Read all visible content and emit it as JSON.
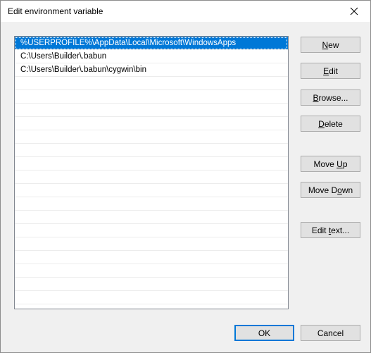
{
  "window": {
    "title": "Edit environment variable",
    "close_icon": "close-icon"
  },
  "paths": {
    "items": [
      {
        "value": "%USERPROFILE%\\AppData\\Local\\Microsoft\\WindowsApps",
        "selected": true
      },
      {
        "value": "C:\\Users\\Builder\\.babun",
        "selected": false
      },
      {
        "value": "C:\\Users\\Builder\\.babun\\cygwin\\bin",
        "selected": false
      }
    ],
    "empty_rows": 17
  },
  "buttons": {
    "new": {
      "pre": "",
      "mnemonic": "N",
      "post": "ew"
    },
    "edit": {
      "pre": "",
      "mnemonic": "E",
      "post": "dit"
    },
    "browse": {
      "pre": "",
      "mnemonic": "B",
      "post": "rowse..."
    },
    "delete": {
      "pre": "",
      "mnemonic": "D",
      "post": "elete"
    },
    "move_up": {
      "pre": "Move ",
      "mnemonic": "U",
      "post": "p"
    },
    "move_down": {
      "pre": "Move D",
      "mnemonic": "o",
      "post": "wn"
    },
    "edit_text": {
      "pre": "Edit ",
      "mnemonic": "t",
      "post": "ext..."
    },
    "ok": "OK",
    "cancel": "Cancel"
  },
  "colors": {
    "selection": "#0078d7",
    "accent_border": "#0078d7"
  }
}
